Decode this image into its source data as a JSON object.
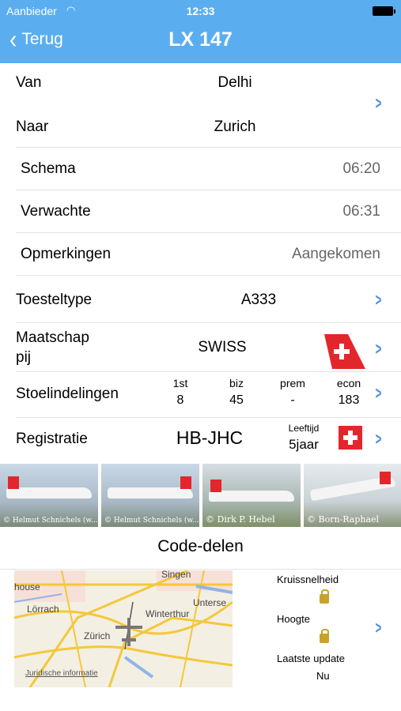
{
  "status": {
    "carrier": "Aanbieder",
    "time": "12:33"
  },
  "nav": {
    "back_label": "Terug",
    "title": "LX 147"
  },
  "route": {
    "from_label": "Van",
    "from_value": "Delhi",
    "to_label": "Naar",
    "to_value": "Zurich"
  },
  "schedule": {
    "label": "Schema",
    "value": "06:20"
  },
  "expected": {
    "label": "Verwachte",
    "value": "06:31"
  },
  "remarks": {
    "label": "Opmerkingen",
    "value": "Aangekomen"
  },
  "aircraft": {
    "label": "Toesteltype",
    "value": "A333"
  },
  "airline": {
    "label_line1": "Maatschap",
    "label_line2": "pij",
    "value": "SWISS"
  },
  "seats": {
    "label": "Stoelindelingen",
    "columns": [
      {
        "head": "1st",
        "value": "8"
      },
      {
        "head": "biz",
        "value": "45"
      },
      {
        "head": "prem",
        "value": "-"
      },
      {
        "head": "econ",
        "value": "183"
      }
    ]
  },
  "registration": {
    "label": "Registratie",
    "value": "HB-JHC",
    "age_label": "Leeftijd",
    "age_value": "5jaar"
  },
  "photos": [
    {
      "credit": "© Helmut Schnichels (w..."
    },
    {
      "credit": "© Helmut Schnichels (w..."
    },
    {
      "credit": "© Dirk P. Hebel"
    },
    {
      "credit": "© Born-Raphael"
    }
  ],
  "codeshare": {
    "title": "Code-delen"
  },
  "map": {
    "labels": [
      "Singen",
      "house",
      "Lörrach",
      "Unterse",
      "Winterthur",
      "Zürich"
    ],
    "legal": "Juridische informatie"
  },
  "flight_info": {
    "speed_label": "Kruissnelheid",
    "altitude_label": "Hoogte",
    "update_label": "Laatste update",
    "update_value": "Nu"
  },
  "colors": {
    "header": "#5aaef0",
    "accent": "#4a90e2",
    "swiss_red": "#e3262c"
  }
}
